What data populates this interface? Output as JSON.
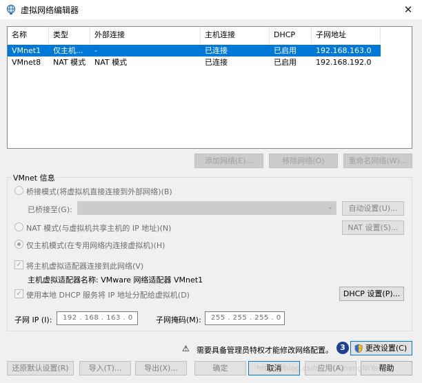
{
  "window": {
    "title": "虚拟网络编辑器",
    "close_glyph": "✕"
  },
  "table": {
    "columns": [
      "名称",
      "类型",
      "外部连接",
      "主机连接",
      "DHCP",
      "子网地址"
    ],
    "rows": [
      [
        "VMnet1",
        "仅主机...",
        "-",
        "已连接",
        "已启用",
        "192.168.163.0"
      ],
      [
        "VMnet8",
        "NAT 模式",
        "NAT 模式",
        "已连接",
        "已启用",
        "192.168.192.0"
      ]
    ],
    "selected_row": 0
  },
  "list_buttons": {
    "add": "添加网络(E)...",
    "remove": "移除网络(O)",
    "rename": "重命名网络(W)..."
  },
  "vmnet_info": {
    "title": "VMnet 信息",
    "bridged_label": "桥接模式(将虚拟机直接连接到外部网络)(B)",
    "bridged_to_label": "已桥接至(G):",
    "bridged_to_value": "",
    "auto_settings": "自动设置(U)...",
    "nat_label": "NAT 模式(与虚拟机共享主机的 IP 地址)(N)",
    "nat_settings": "NAT 设置(S)...",
    "hostonly_label": "仅主机模式(在专用网络内连接虚拟机)(H)",
    "connect_adapter_label": "将主机虚拟适配器连接到此网络(V)",
    "adapter_name_label": "主机虚拟适配器名称: VMware 网络适配器 VMnet1",
    "dhcp_label": "使用本地 DHCP 服务将 IP 地址分配给虚拟机(D)",
    "dhcp_settings": "DHCP 设置(P)...",
    "subnet_ip_label": "子网 IP (I):",
    "subnet_ip_value": "192 . 168 . 163 .  0",
    "subnet_mask_label": "子网掩码(M):",
    "subnet_mask_value": "255 . 255 . 255 .  0"
  },
  "notice": {
    "warning_icon": "⚠",
    "text": "需要具备管理员特权才能修改网络配置。",
    "badge": "3",
    "change_settings": "更改设置(C)"
  },
  "bottom_buttons": {
    "restore": "还原默认设置(R)",
    "import": "导入(T)...",
    "export": "导出(X)...",
    "ok": "确定",
    "cancel": "取消",
    "apply": "应用(A)",
    "help": "帮助"
  },
  "watermark": "https://blog.csdn.net/ChengNiYang",
  "colors": {
    "selection": "#0078d7",
    "dialog_bg": "#f0f0f0",
    "badge": "#1d3f8f"
  }
}
